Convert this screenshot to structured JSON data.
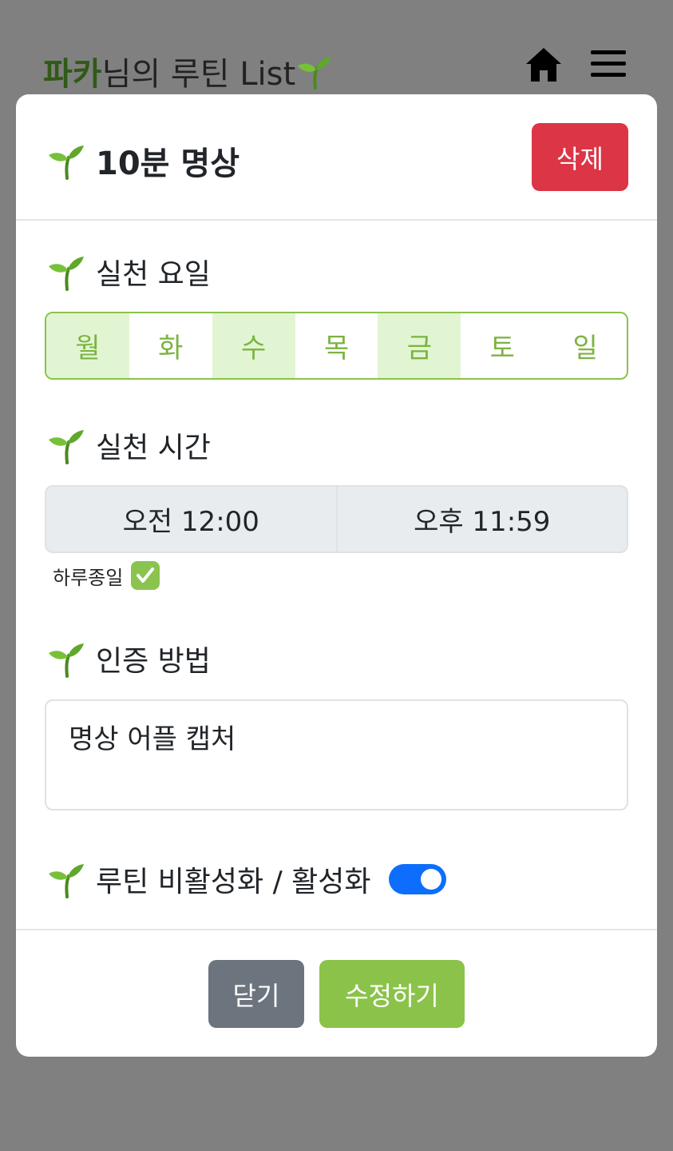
{
  "header": {
    "user_name": "파카",
    "title_suffix": "님의 루틴 List"
  },
  "modal": {
    "title": "10분 명상",
    "delete_label": "삭제",
    "days_label": "실천 요일",
    "days": [
      {
        "label": "월",
        "selected": true
      },
      {
        "label": "화",
        "selected": false
      },
      {
        "label": "수",
        "selected": true
      },
      {
        "label": "목",
        "selected": false
      },
      {
        "label": "금",
        "selected": true
      },
      {
        "label": "토",
        "selected": false
      },
      {
        "label": "일",
        "selected": false
      }
    ],
    "time_label": "실천 시간",
    "start_time": "오전 12:00",
    "end_time": "오후 11:59",
    "all_day_label": "하루종일",
    "all_day_checked": true,
    "method_label": "인증 방법",
    "method_value": "명상 어플 캡처",
    "toggle_label": "루틴 비활성화 / 활성화",
    "toggle_on": true,
    "close_label": "닫기",
    "edit_label": "수정하기"
  },
  "colors": {
    "brand_green": "#8bc34a",
    "danger": "#dc3545",
    "secondary": "#6c757d",
    "toggle": "#0d6efd"
  },
  "icons": [
    "sprout-icon",
    "home-icon",
    "hamburger-menu-icon",
    "checkmark-icon"
  ]
}
